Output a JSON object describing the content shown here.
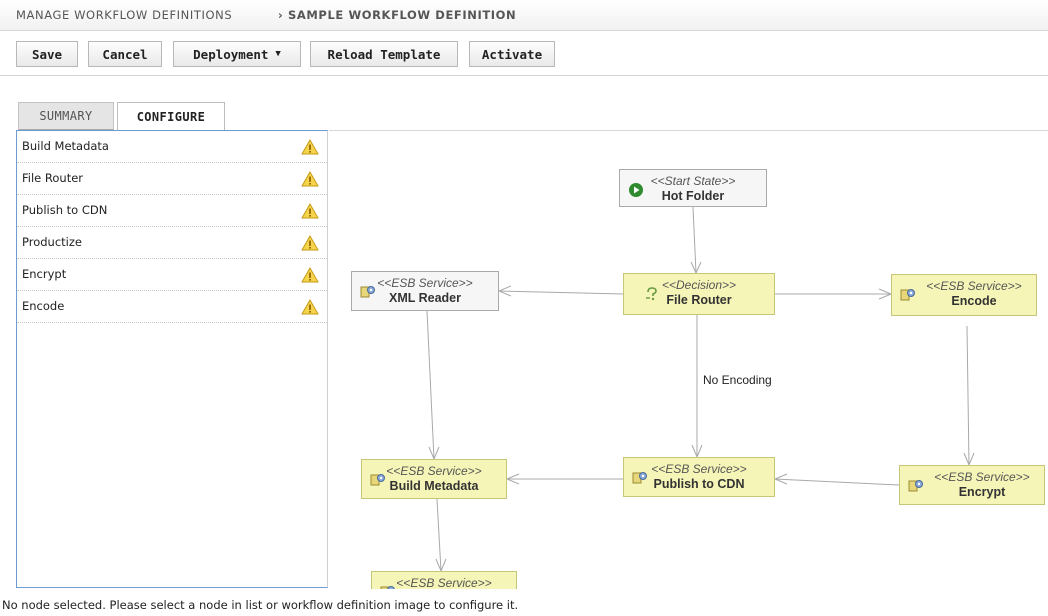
{
  "breadcrumb": {
    "parent": "Manage Workflow Definitions",
    "separator": "›",
    "current": "Sample Workflow Definition"
  },
  "toolbar": {
    "save": "Save",
    "cancel": "Cancel",
    "deployment": "Deployment",
    "reload": "Reload Template",
    "activate": "Activate"
  },
  "tabs": {
    "summary": "Summary",
    "configure": "Configure",
    "active": "configure"
  },
  "node_list": [
    {
      "label": "Build Metadata",
      "status_icon": "warning-icon"
    },
    {
      "label": "File Router",
      "status_icon": "warning-icon"
    },
    {
      "label": "Publish to CDN",
      "status_icon": "warning-icon"
    },
    {
      "label": "Productize",
      "status_icon": "warning-icon"
    },
    {
      "label": "Encrypt",
      "status_icon": "warning-icon"
    },
    {
      "label": "Encode",
      "status_icon": "warning-icon"
    }
  ],
  "diagram": {
    "nodes": {
      "hot_folder": {
        "stereotype": "<<Start State>>",
        "name": "Hot Folder",
        "icon": "play-icon"
      },
      "xml_reader": {
        "stereotype": "<<ESB Service>>",
        "name": "XML Reader",
        "icon": "service-icon"
      },
      "file_router": {
        "stereotype": "<<Decision>>",
        "name": "File Router",
        "icon": "decision-icon"
      },
      "encode": {
        "stereotype": "<<ESB Service>>",
        "name": "Encode",
        "icon": "service-icon"
      },
      "build_metadata": {
        "stereotype": "<<ESB Service>>",
        "name": "Build Metadata",
        "icon": "service-icon"
      },
      "publish_cdn": {
        "stereotype": "<<ESB Service>>",
        "name": "Publish to CDN",
        "icon": "service-icon"
      },
      "encrypt": {
        "stereotype": "<<ESB Service>>",
        "name": "Encrypt",
        "icon": "service-icon"
      },
      "bottom_partial": {
        "stereotype": "<<ESB Service>>",
        "name": "",
        "icon": "service-icon"
      }
    },
    "edge_labels": {
      "no_encoding": "No Encoding"
    },
    "colors": {
      "service_fill": "#f5f5b8",
      "state_fill": "#f6f6f6",
      "selection_border": "#6e9bd0"
    }
  },
  "status_message": "No node selected. Please select a node in list or workflow definition image to configure it."
}
